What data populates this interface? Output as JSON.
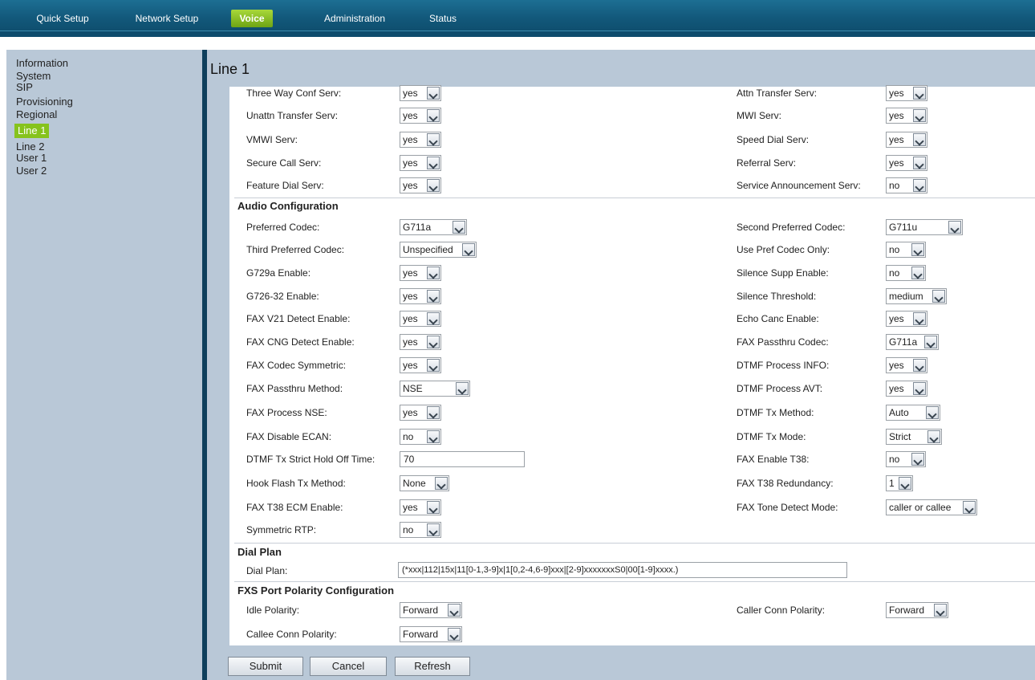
{
  "nav": {
    "tabs": [
      {
        "label": "Quick Setup"
      },
      {
        "label": "Network Setup"
      },
      {
        "label": "Voice"
      },
      {
        "label": "Administration"
      },
      {
        "label": "Status"
      }
    ],
    "active_tab": "Voice"
  },
  "sidebar": {
    "items": [
      {
        "label": "Information"
      },
      {
        "label": "System"
      },
      {
        "label": "SIP"
      },
      {
        "label": "Provisioning"
      },
      {
        "label": "Regional"
      },
      {
        "label": "Line 1"
      },
      {
        "label": "Line 2"
      },
      {
        "label": "User 1"
      },
      {
        "label": "User 2"
      }
    ],
    "active_item": "Line 1"
  },
  "page": {
    "title": "Line 1"
  },
  "services": [
    {
      "left_label": "Three Way Conf Serv:",
      "left_value": "yes",
      "right_label": "Attn Transfer Serv:",
      "right_value": "yes"
    },
    {
      "left_label": "Unattn Transfer Serv:",
      "left_value": "yes",
      "right_label": "MWI Serv:",
      "right_value": "yes"
    },
    {
      "left_label": "VMWI Serv:",
      "left_value": "yes",
      "right_label": "Speed Dial Serv:",
      "right_value": "yes"
    },
    {
      "left_label": "Secure Call Serv:",
      "left_value": "yes",
      "right_label": "Referral Serv:",
      "right_value": "yes"
    },
    {
      "left_label": "Feature Dial Serv:",
      "left_value": "yes",
      "right_label": "Service Announcement Serv:",
      "right_value": "no"
    }
  ],
  "audio": {
    "section_title": "Audio Configuration",
    "rows": [
      {
        "left_label": "Preferred Codec:",
        "left_value": "G711a",
        "right_label": "Second Preferred Codec:",
        "right_value": "G711u"
      },
      {
        "left_label": "Third Preferred Codec:",
        "left_value": "Unspecified",
        "right_label": "Use Pref Codec Only:",
        "right_value": "no"
      },
      {
        "left_label": "G729a Enable:",
        "left_value": "yes",
        "right_label": "Silence Supp Enable:",
        "right_value": "no"
      },
      {
        "left_label": "G726-32 Enable:",
        "left_value": "yes",
        "right_label": "Silence Threshold:",
        "right_value": "medium"
      },
      {
        "left_label": "FAX V21 Detect Enable:",
        "left_value": "yes",
        "right_label": "Echo Canc Enable:",
        "right_value": "yes"
      },
      {
        "left_label": "FAX CNG Detect Enable:",
        "left_value": "yes",
        "right_label": "FAX Passthru Codec:",
        "right_value": "G711a"
      },
      {
        "left_label": "FAX Codec Symmetric:",
        "left_value": "yes",
        "right_label": "DTMF Process INFO:",
        "right_value": "yes"
      },
      {
        "left_label": "FAX Passthru Method:",
        "left_value": "NSE",
        "right_label": "DTMF Process AVT:",
        "right_value": "yes"
      },
      {
        "left_label": "FAX Process NSE:",
        "left_value": "yes",
        "right_label": "DTMF Tx Method:",
        "right_value": "Auto"
      },
      {
        "left_label": "FAX Disable ECAN:",
        "left_value": "no",
        "right_label": "DTMF Tx Mode:",
        "right_value": "Strict"
      },
      {
        "left_label": "DTMF Tx Strict Hold Off Time:",
        "left_value": "70",
        "right_label": "FAX Enable T38:",
        "right_value": "no"
      },
      {
        "left_label": "Hook Flash Tx Method:",
        "left_value": "None",
        "right_label": "FAX T38 Redundancy:",
        "right_value": "1"
      },
      {
        "left_label": "FAX T38 ECM Enable:",
        "left_value": "yes",
        "right_label": "FAX Tone Detect Mode:",
        "right_value": "caller or callee"
      },
      {
        "left_label": "Symmetric RTP:",
        "left_value": "no"
      }
    ]
  },
  "dial_plan": {
    "section_title": "Dial Plan",
    "label": "Dial Plan:",
    "value": "(*xxx|112|15x|11[0-1,3-9]x|1[0,2-4,6-9]xxx|[2-9]xxxxxxxS0|00[1-9]xxxx.)"
  },
  "fxs": {
    "section_title": "FXS Port Polarity Configuration",
    "rows": [
      {
        "left_label": "Idle Polarity:",
        "left_value": "Forward",
        "right_label": "Caller Conn Polarity:",
        "right_value": "Forward"
      },
      {
        "left_label": "Callee Conn Polarity:",
        "left_value": "Forward"
      }
    ]
  },
  "buttons": {
    "submit": "Submit",
    "cancel": "Cancel",
    "refresh": "Refresh"
  }
}
